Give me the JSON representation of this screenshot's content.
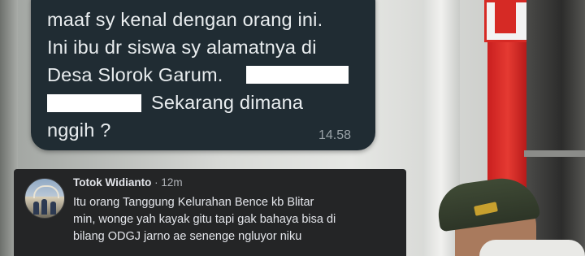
{
  "chat_bubble": {
    "lines": [
      "maaf sy kenal dengan orang ini.",
      "Ini ibu dr siswa sy alamatnya di",
      "Desa Slorok Garum.",
      "Sekarang dimana",
      "nggih ?"
    ],
    "time": "14.58",
    "colors": {
      "bubble": "#202c33",
      "text": "#e9edef",
      "time": "#9aa3a8"
    }
  },
  "comment": {
    "author": "Totok Widianto",
    "separator": "·",
    "age": "12m",
    "lines": [
      "Itu orang Tanggung Kelurahan Bence kb Blitar",
      "min, wonge yah kayak gitu tapi gak bahaya bisa di",
      "bilang ODGJ jarno ae senenge ngluyor niku"
    ],
    "avatar_icon": "profile-photo",
    "colors": {
      "card": "#242526",
      "name": "#e4e6eb",
      "meta": "#b0b3b8"
    }
  }
}
